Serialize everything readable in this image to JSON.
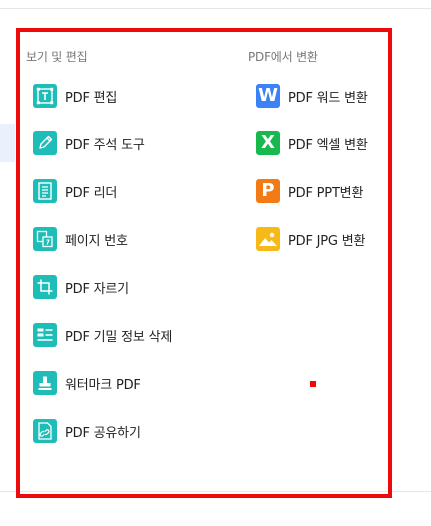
{
  "left_section": {
    "heading": "보기 및 편집",
    "items": [
      {
        "label": "PDF 편집"
      },
      {
        "label": "PDF 주석 도구"
      },
      {
        "label": "PDF 리더"
      },
      {
        "label": "페이지 번호"
      },
      {
        "label": "PDF 자르기"
      },
      {
        "label": "PDF 기밀 정보 삭제"
      },
      {
        "label": "워터마크 PDF"
      },
      {
        "label": "PDF 공유하기"
      }
    ]
  },
  "right_section": {
    "heading": "PDF에서 변환",
    "items": [
      {
        "label": "PDF 워드 변환",
        "icon_letter": "W"
      },
      {
        "label": "PDF 엑셀 변환",
        "icon_letter": "X"
      },
      {
        "label": "PDF PPT변환",
        "icon_letter": "P"
      },
      {
        "label": "PDF JPG 변환"
      }
    ]
  },
  "colors": {
    "teal": "#1fbdb8",
    "word": "#3b82f6",
    "excel": "#17b84d",
    "ppt": "#f27b16",
    "jpg": "#f7b917",
    "highlight": "#ee0a0a"
  }
}
